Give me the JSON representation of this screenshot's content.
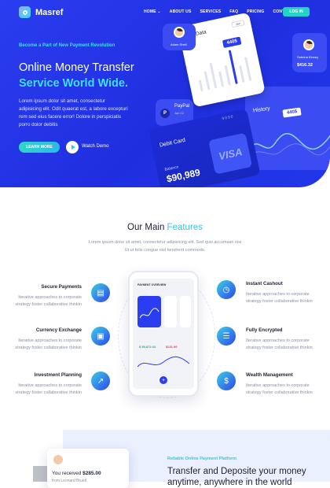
{
  "brand": {
    "name": "Masref"
  },
  "nav": {
    "items": [
      "HOME",
      "ABOUT US",
      "SERVICES",
      "FAQ",
      "PRICING",
      "CONTACT"
    ],
    "home_caret": "⌄",
    "login": "LOG IN"
  },
  "hero": {
    "tagline": "Become a Part of New Payment Revolution",
    "title_line1": "Online Money Transfer",
    "title_line2": "Service World Wide.",
    "paragraph": "Lorem ipsum dolor sit amet, consectetur adipisicing elit. Odit quaerat est, a labore excepturi rem sed eius facere error! Dolore in perspiciatis porro dolor debitis",
    "learn_more": "LEARN MORE",
    "watch_demo": "Watch Demo"
  },
  "dashboard": {
    "adam_name": "Adam Shell",
    "mydata_title": "My Data",
    "mydata_badge": "440$",
    "mydata_dropdown": "Jan",
    "mydata_bars": [
      0.35,
      0.55,
      0.75,
      0.45,
      0.6,
      1.0,
      0.5,
      0.7
    ],
    "sabrina_name": "Sabrina Kinney",
    "sabrina_amount": "$416.32",
    "paypal_title": "PayPal",
    "paypal_date": "Jan 12",
    "history_title": "History",
    "history_badge": "440$",
    "debit_title": "Debit Card",
    "debit_number": "9090",
    "balance_label": "Balance",
    "balance_amount": "$90,989",
    "visa": "VISA"
  },
  "features": {
    "title_plain": "Our Main",
    "title_accent": "Features",
    "description": "Lorem ipsum dolor sit amet, consectetur adipisicing elit. Sed quis accumsan nisi Ut ut felis congue nisl hendrerit commodo.",
    "items_left": [
      {
        "title": "Secure Payments",
        "desc": "Iterative approaches to corporate strategy foster collaborative thinkin",
        "icon": "wallet-icon"
      },
      {
        "title": "Currency Exchange",
        "desc": "Iterative approaches to corporate strategy foster collaborative thinkin",
        "icon": "monitor-chart-icon"
      },
      {
        "title": "Investment Planning",
        "desc": "Iterative approaches to corporate strategy foster collaborative thinkin",
        "icon": "chart-up-icon"
      }
    ],
    "items_right": [
      {
        "title": "Instant Cashout",
        "desc": "Iterative approaches to corporate strategy foster collaborative thinkin",
        "icon": "clock-icon"
      },
      {
        "title": "Fully Encrypted",
        "desc": "Iterative approaches to corporate strategy foster collaborative thinkin",
        "icon": "server-icon"
      },
      {
        "title": "Wealth Management",
        "desc": "Iterative approaches to corporate strategy foster collaborative thinkin",
        "icon": "money-bag-icon"
      }
    ],
    "phone": {
      "header": "PAYMENT OVERVIEW",
      "value1": "$ 59,872.03",
      "value2": "$231.99",
      "fab": "+"
    }
  },
  "transfer": {
    "received_prefix": "You received",
    "received_amount": "$285.00",
    "received_from": "from Leonard Bruell",
    "platform_label": "Reliable Online Payment Platform",
    "heading": "Transfer and Deposite your money anytime, anywhere in the world"
  },
  "colors": {
    "primary": "#2b3df0",
    "accent": "#3ee0ff",
    "teal": "#22d4c6"
  }
}
